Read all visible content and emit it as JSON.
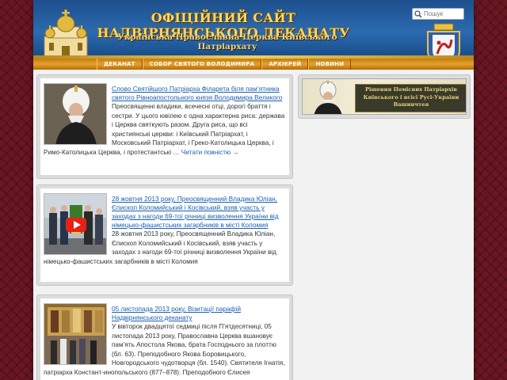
{
  "header": {
    "site_title": "ОФІЦІЙНИЙ САЙТ НАДВІРНЯНСЬКОГО ДЕКАНАТУ",
    "site_subtitle": "Українська Православна Церква Київського Патріархату",
    "search_placeholder": "Пошук"
  },
  "nav": {
    "items": [
      {
        "label": "ДЕКАНАТ"
      },
      {
        "label": "СОБОР СВЯТОГО ВОЛОДИМИРА"
      },
      {
        "label": "АРХІЄРЕЙ"
      },
      {
        "label": "НОВИНИ"
      }
    ]
  },
  "posts": [
    {
      "title": "Слово Святійшого Патріарха Філарета біля пам’ятника святого Рівноапостольного князя Володимира Великого",
      "excerpt": "Преосвященні владики, всечесні отці, дорогі браття і сестри. У цього ювілею є одна характерна риса: держава і Церква святкують разом. Друга риса, що всі християнські церкви: і Київський Патріархат, і Московський Патріархат, і Греко-Католицька Церква, і Римо-Католицька Церква, і протестантські …",
      "read_more": "Читати повністю →"
    },
    {
      "title": "28 жовтня 2013 року, Преосвященний Владика Юліан, Єпископ Коломийський і Косівський, взяв участь у заходах з нагоди 69-тої річниці визволення України від німецько-фашистських загарбників в місті Коломия",
      "excerpt": "28 жовтня 2013 року, Преосвященний Владика Юліан, Єпископ Коломийський і Косівський, взяв участь у заходах з нагоди 69-тої річниці визволення України від німецько-фашистських загарбників в місті Коломия"
    },
    {
      "title": "05 листопада 2013 року, Візитації парафій Надвірнянського деканату",
      "excerpt": "У вівторок двадцятої седмиці після П’ятдесятниці, 05 листопада 2013 року, Православна Церква вшановує пам’ять Апостола Якова, брата Господнього за плоттю (бл. 63). Преподобного Якова Боровицького, Новгородського чудотворця (бл. 1540). Святителя Ігнатія, патріарха Констант-инопольського (877–878). Преподобного Єлисея"
    }
  ],
  "sidebar": {
    "banner_text": "Рішення Помісних Патріархів Київського і всієї Русі-України Вашинчтея"
  },
  "colors": {
    "background": "#6a1722",
    "header_blue": "#2b6bb0",
    "nav_orange": "#e6a12a",
    "link_blue": "#1a5fb4",
    "title_gold": "#f5d76e"
  }
}
